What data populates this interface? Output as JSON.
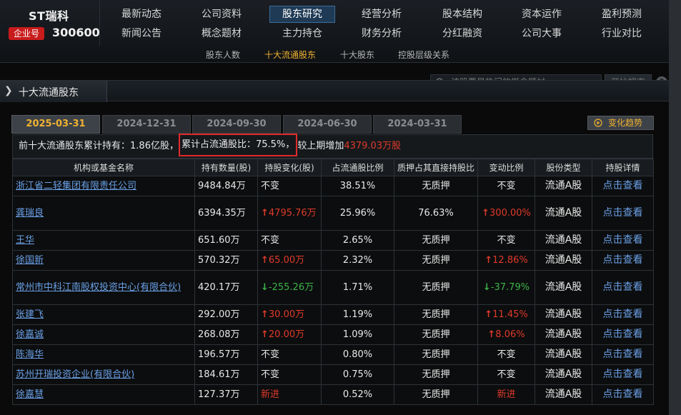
{
  "brand": {
    "stock_name": "ST瑞科",
    "corp_tag": "企业号",
    "stock_code": "300600"
  },
  "nav": {
    "row1": [
      "最新动态",
      "公司资料",
      "股东研究",
      "经营分析",
      "股本结构",
      "资本运作",
      "盈利预测"
    ],
    "row2": [
      "新闻公告",
      "概念题材",
      "主力持仓",
      "财务分析",
      "分红融资",
      "公司大事",
      "行业对比"
    ],
    "active": "股东研究"
  },
  "subnav": {
    "items": [
      "股东人数",
      "十大流通股东",
      "十大股东",
      "控股层级关系"
    ],
    "active": "十大流通股东"
  },
  "section": {
    "title": "十大流通股东"
  },
  "search": {
    "placeholder": "该股票最热门的概念题材",
    "button_label": "开始搜索",
    "help_label": "?"
  },
  "tabs": {
    "dates": [
      "2025-03-31",
      "2024-12-31",
      "2024-09-30",
      "2024-06-30",
      "2024-03-31"
    ],
    "active_index": 0
  },
  "trend_button": {
    "label": "变化趋势",
    "icon": "play-circle-icon"
  },
  "summary": {
    "prefix": "前十大流通股东累计持有：",
    "total": "1.86亿股",
    "ratio_text": "累计占流通股比：",
    "ratio_value": "75.5%",
    "compare_text": "较上期增加",
    "increase": "4379.03万股"
  },
  "table": {
    "headers": [
      "机构或基金名称",
      "持有数量(股)",
      "持股变化(股)",
      "占流通股比例",
      "质押占其直接持股比",
      "变动比例",
      "股份类型",
      "持股详情"
    ],
    "rows": [
      {
        "name": "浙江省二轻集团有限责任公司",
        "amount": "9484.84万",
        "change": "不变",
        "change_dir": "none",
        "ratio": "38.51%",
        "pledge": "无质押",
        "change_ratio": "不变",
        "ratio_dir": "none",
        "type": "流通A股",
        "detail": "点击查看"
      },
      {
        "name": "龚瑞良",
        "amount": "6394.35万",
        "change": "4795.76万",
        "change_dir": "up",
        "ratio": "25.96%",
        "pledge": "76.63%",
        "change_ratio": "300.00%",
        "ratio_dir": "up",
        "type": "流通A股",
        "detail": "点击查看"
      },
      {
        "name": "王华",
        "amount": "651.60万",
        "change": "不变",
        "change_dir": "none",
        "ratio": "2.65%",
        "pledge": "无质押",
        "change_ratio": "不变",
        "ratio_dir": "none",
        "type": "流通A股",
        "detail": "点击查看"
      },
      {
        "name": "徐国新",
        "amount": "570.32万",
        "change": "65.00万",
        "change_dir": "up",
        "ratio": "2.32%",
        "pledge": "无质押",
        "change_ratio": "12.86%",
        "ratio_dir": "up",
        "type": "流通A股",
        "detail": "点击查看"
      },
      {
        "name": "常州市中科江南股权投资中心(有限合伙)",
        "amount": "420.17万",
        "change": "-255.26万",
        "change_dir": "down",
        "ratio": "1.71%",
        "pledge": "无质押",
        "change_ratio": "-37.79%",
        "ratio_dir": "down",
        "type": "流通A股",
        "detail": "点击查看"
      },
      {
        "name": "张建飞",
        "amount": "292.00万",
        "change": "30.00万",
        "change_dir": "up",
        "ratio": "1.19%",
        "pledge": "无质押",
        "change_ratio": "11.45%",
        "ratio_dir": "up",
        "type": "流通A股",
        "detail": "点击查看"
      },
      {
        "name": "徐嘉诚",
        "amount": "268.08万",
        "change": "20.00万",
        "change_dir": "up",
        "ratio": "1.09%",
        "pledge": "无质押",
        "change_ratio": "8.06%",
        "ratio_dir": "up",
        "type": "流通A股",
        "detail": "点击查看"
      },
      {
        "name": "陈海华",
        "amount": "196.57万",
        "change": "不变",
        "change_dir": "none",
        "ratio": "0.80%",
        "pledge": "无质押",
        "change_ratio": "不变",
        "ratio_dir": "none",
        "type": "流通A股",
        "detail": "点击查看"
      },
      {
        "name": "苏州开瑞投资企业(有限合伙)",
        "amount": "184.61万",
        "change": "不变",
        "change_dir": "none",
        "ratio": "0.75%",
        "pledge": "无质押",
        "change_ratio": "不变",
        "ratio_dir": "none",
        "type": "流通A股",
        "detail": "点击查看"
      },
      {
        "name": "徐嘉慧",
        "amount": "127.37万",
        "change": "新进",
        "change_dir": "new",
        "ratio": "0.52%",
        "pledge": "无质押",
        "change_ratio": "新进",
        "ratio_dir": "new",
        "type": "流通A股",
        "detail": "点击查看"
      }
    ]
  },
  "colors": {
    "accent": "#f0b132",
    "up": "#e03a2b",
    "down": "#3cb44a",
    "link": "#6aa0e6",
    "highlight_box": "#e02a2a"
  }
}
